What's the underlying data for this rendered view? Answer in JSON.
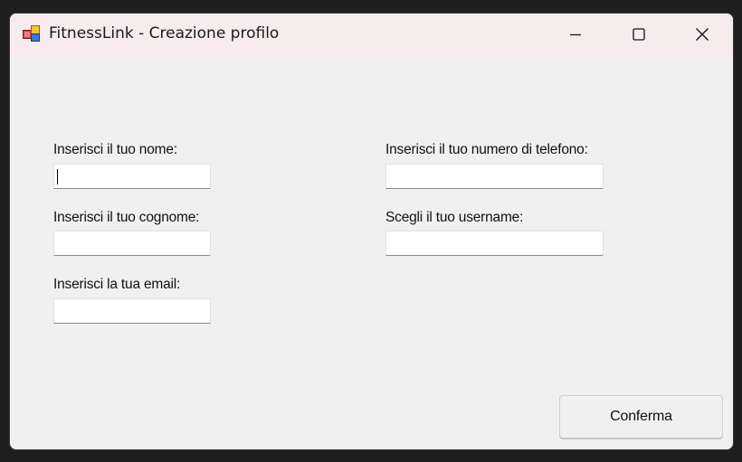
{
  "window": {
    "title": "FitnessLink - Creazione profilo",
    "icon": "app-icon",
    "controls": {
      "minimize_icon": "minimize-icon",
      "maximize_icon": "maximize-icon",
      "close_icon": "close-icon"
    },
    "colors": {
      "titlebar": "#f7ebee",
      "background": "#f0f0f0"
    }
  },
  "form": {
    "nome": {
      "label": "Inserisci il tuo nome:",
      "value": ""
    },
    "cognome": {
      "label": "Inserisci il tuo cognome:",
      "value": ""
    },
    "email": {
      "label": "Inserisci la tua email:",
      "value": ""
    },
    "telefono": {
      "label": "Inserisci il tuo numero di telefono:",
      "value": ""
    },
    "username": {
      "label": "Scegli il tuo username:",
      "value": ""
    },
    "confirm_label": "Conferma"
  }
}
